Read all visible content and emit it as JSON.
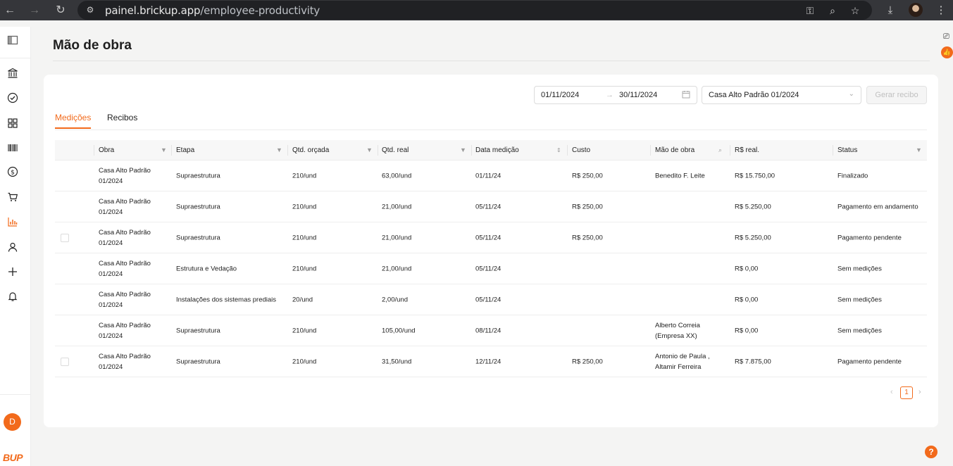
{
  "browser": {
    "url_host": "painel.brickup.app",
    "url_path": "/employee-productivity"
  },
  "page": {
    "title": "Mão de obra"
  },
  "filters": {
    "date_start": "01/11/2024",
    "date_end": "30/11/2024",
    "date_arrow": "→",
    "obra_selected": "Casa Alto Padrão 01/2024",
    "generate_button": "Gerar recibo"
  },
  "tabs": [
    {
      "label": "Medições",
      "active": true
    },
    {
      "label": "Recibos",
      "active": false
    }
  ],
  "table": {
    "headers": {
      "obra": "Obra",
      "etapa": "Etapa",
      "qtd_orcada": "Qtd. orçada",
      "qtd_real": "Qtd. real",
      "data_medicao": "Data medição",
      "custo": "Custo",
      "mao_de_obra": "Mão de obra",
      "rs_real": "R$ real.",
      "status": "Status"
    },
    "rows": [
      {
        "obra_line1": "Casa Alto Padrão",
        "obra_line2": "01/2024",
        "etapa": "Supraestrutura",
        "qtd_orcada": "210/und",
        "qtd_real": "63,00/und",
        "data": "01/11/24",
        "custo": "R$ 250,00",
        "mao_line1": "Benedito F. Leite",
        "mao_line2": "",
        "rs_real": "R$ 15.750,00",
        "status": "Finalizado"
      },
      {
        "obra_line1": "Casa Alto Padrão",
        "obra_line2": "01/2024",
        "etapa": "Supraestrutura",
        "qtd_orcada": "210/und",
        "qtd_real": "21,00/und",
        "data": "05/11/24",
        "custo": "R$ 250,00",
        "mao_line1": "",
        "mao_line2": "",
        "rs_real": "R$ 5.250,00",
        "status": "Pagamento em andamento"
      },
      {
        "obra_line1": "Casa Alto Padrão",
        "obra_line2": "01/2024",
        "etapa": "Supraestrutura",
        "qtd_orcada": "210/und",
        "qtd_real": "21,00/und",
        "data": "05/11/24",
        "custo": "R$ 250,00",
        "mao_line1": "",
        "mao_line2": "",
        "rs_real": "R$ 5.250,00",
        "status": "Pagamento pendente"
      },
      {
        "obra_line1": "Casa Alto Padrão",
        "obra_line2": "01/2024",
        "etapa": "Estrutura e Vedação",
        "qtd_orcada": "210/und",
        "qtd_real": "21,00/und",
        "data": "05/11/24",
        "custo": "",
        "mao_line1": "",
        "mao_line2": "",
        "rs_real": "R$ 0,00",
        "status": "Sem medições"
      },
      {
        "obra_line1": "Casa Alto Padrão",
        "obra_line2": "01/2024",
        "etapa": "Instalações dos sistemas prediais",
        "qtd_orcada": "20/und",
        "qtd_real": "2,00/und",
        "data": "05/11/24",
        "custo": "",
        "mao_line1": "",
        "mao_line2": "",
        "rs_real": "R$ 0,00",
        "status": "Sem medições"
      },
      {
        "obra_line1": "Casa Alto Padrão",
        "obra_line2": "01/2024",
        "etapa": "Supraestrutura",
        "qtd_orcada": "210/und",
        "qtd_real": "105,00/und",
        "data": "08/11/24",
        "custo": "",
        "mao_line1": "Alberto Correia",
        "mao_line2": "(Empresa XX)",
        "rs_real": "R$ 0,00",
        "status": "Sem medições"
      },
      {
        "obra_line1": "Casa Alto Padrão",
        "obra_line2": "01/2024",
        "etapa": "Supraestrutura",
        "qtd_orcada": "210/und",
        "qtd_real": "31,50/und",
        "data": "12/11/24",
        "custo": "R$ 250,00",
        "mao_line1": "Antonio de Paula ,",
        "mao_line2": "Altamir Ferreira",
        "rs_real": "R$ 7.875,00",
        "status": "Pagamento pendente"
      }
    ]
  },
  "pagination": {
    "current_page": "1"
  },
  "user": {
    "avatar_initial": "D"
  },
  "brand": {
    "logo_text": "BUP",
    "accent_color": "#f26a1b"
  },
  "icons": {
    "sidebar": [
      "sidebar-toggle-icon",
      "bank-icon",
      "check-circle-icon",
      "grid-icon",
      "barcode-icon",
      "dollar-icon",
      "cart-icon",
      "bar-chart-icon",
      "user-icon",
      "plus-icon",
      "bell-icon"
    ]
  }
}
